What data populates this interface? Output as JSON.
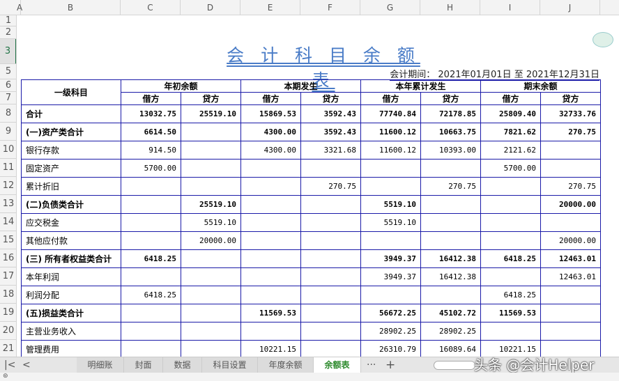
{
  "columns": [
    "A",
    "B",
    "C",
    "D",
    "E",
    "F",
    "G",
    "H",
    "I",
    "J"
  ],
  "row_numbers": [
    "1",
    "2",
    "3",
    "5",
    "6",
    "7",
    "8",
    "9",
    "10",
    "11",
    "12",
    "13",
    "14",
    "15",
    "16",
    "17",
    "18",
    "19",
    "20",
    "21"
  ],
  "title": "会 计 科 目 余 额 表",
  "period": "会计期间： 2021年01月01日  至  2021年12月31日",
  "header": {
    "subject": "一级科目",
    "groups": [
      "年初余额",
      "本期发生",
      "本年累计发生",
      "期末余额"
    ],
    "debit": "借方",
    "credit": "贷方"
  },
  "rows": [
    {
      "name": "合计",
      "bold": true,
      "v": [
        "13032.75",
        "25519.10",
        "15869.53",
        "3592.43",
        "77740.84",
        "72178.85",
        "25809.40",
        "32733.76"
      ]
    },
    {
      "name": "(一)资产类合计",
      "bold": true,
      "v": [
        "6614.50",
        "",
        "4300.00",
        "3592.43",
        "11600.12",
        "10663.75",
        "7821.62",
        "270.75"
      ]
    },
    {
      "name": "银行存款",
      "v": [
        "914.50",
        "",
        "4300.00",
        "3321.68",
        "11600.12",
        "10393.00",
        "2121.62",
        ""
      ]
    },
    {
      "name": "固定资产",
      "v": [
        "5700.00",
        "",
        "",
        "",
        "",
        "",
        "5700.00",
        ""
      ]
    },
    {
      "name": "累计折旧",
      "v": [
        "",
        "",
        "",
        "270.75",
        "",
        "270.75",
        "",
        "270.75"
      ]
    },
    {
      "name": "(二)负债类合计",
      "bold": true,
      "v": [
        "",
        "25519.10",
        "",
        "",
        "5519.10",
        "",
        "",
        "20000.00"
      ]
    },
    {
      "name": "应交税金",
      "v": [
        "",
        "5519.10",
        "",
        "",
        "5519.10",
        "",
        "",
        ""
      ]
    },
    {
      "name": "其他应付款",
      "v": [
        "",
        "20000.00",
        "",
        "",
        "",
        "",
        "",
        "20000.00"
      ]
    },
    {
      "name": "(三) 所有者权益类合计",
      "bold": true,
      "v": [
        "6418.25",
        "",
        "",
        "",
        "3949.37",
        "16412.38",
        "6418.25",
        "12463.01"
      ]
    },
    {
      "name": "本年利润",
      "v": [
        "",
        "",
        "",
        "",
        "3949.37",
        "16412.38",
        "",
        "12463.01"
      ]
    },
    {
      "name": "利润分配",
      "v": [
        "6418.25",
        "",
        "",
        "",
        "",
        "",
        "6418.25",
        ""
      ]
    },
    {
      "name": "(五)损益类合计",
      "bold": true,
      "v": [
        "",
        "",
        "11569.53",
        "",
        "56672.25",
        "45102.72",
        "11569.53",
        ""
      ]
    },
    {
      "name": "主营业务收入",
      "v": [
        "",
        "",
        "",
        "",
        "28902.25",
        "28902.25",
        "",
        ""
      ]
    },
    {
      "name": "管理费用",
      "v": [
        "",
        "",
        "10221.15",
        "",
        "26310.79",
        "16089.64",
        "10221.15",
        ""
      ]
    }
  ],
  "tabs": [
    "明细账",
    "封面",
    "数据",
    "科目设置",
    "年度余额",
    "余额表"
  ],
  "active_tab": "余额表",
  "tab_more": "···",
  "tab_add": "+",
  "watermark": "头条 @会计Helper"
}
